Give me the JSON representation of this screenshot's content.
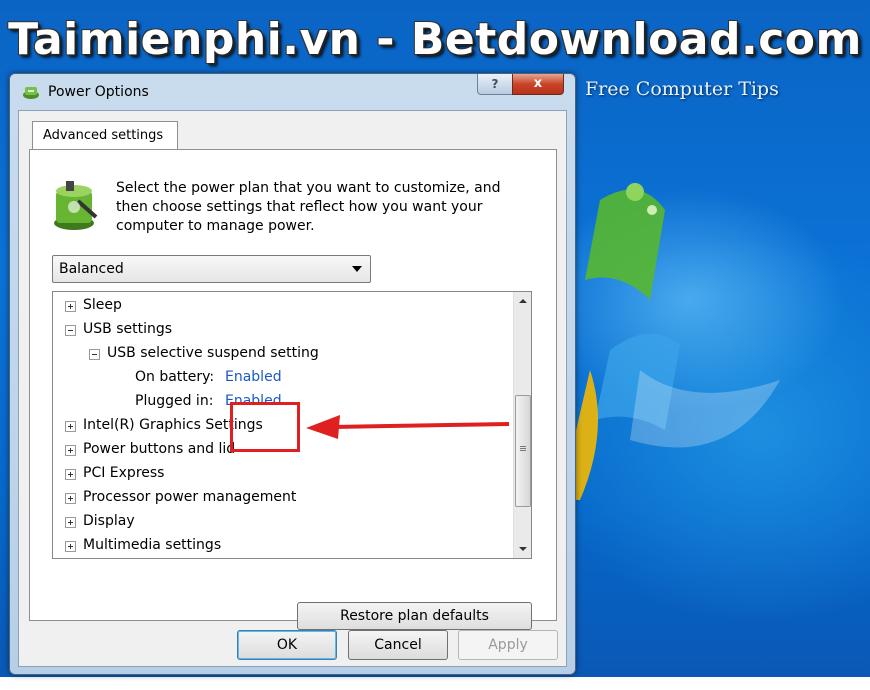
{
  "banner": {
    "title": "Taimienphi.vn - Betdownload.com",
    "tagline": "Free Computer Tips"
  },
  "window": {
    "title": "Power Options",
    "help_label": "?",
    "close_label": "x",
    "tab_label": "Advanced settings",
    "description": "Select the power plan that you want to customize, and then choose settings that reflect how you want your computer to manage power.",
    "plan_select": {
      "value": "Balanced"
    },
    "tree": [
      {
        "label": "Sleep",
        "expander": "plus",
        "indent": 0
      },
      {
        "label": "USB settings",
        "expander": "minus",
        "indent": 0
      },
      {
        "label": "USB selective suspend setting",
        "expander": "minus",
        "indent": 1
      },
      {
        "label": "On battery:",
        "value": "Enabled",
        "indent": 2
      },
      {
        "label": "Plugged in:",
        "value": "Enabled",
        "indent": 2
      },
      {
        "label": "Intel(R) Graphics Settings",
        "expander": "plus",
        "indent": 0
      },
      {
        "label": "Power buttons and lid",
        "expander": "plus",
        "indent": 0
      },
      {
        "label": "PCI Express",
        "expander": "plus",
        "indent": 0
      },
      {
        "label": "Processor power management",
        "expander": "plus",
        "indent": 0
      },
      {
        "label": "Display",
        "expander": "plus",
        "indent": 0
      },
      {
        "label": "Multimedia settings",
        "expander": "plus",
        "indent": 0
      }
    ],
    "restore_label": "Restore plan defaults",
    "ok_label": "OK",
    "cancel_label": "Cancel",
    "apply_label": "Apply"
  },
  "colors": {
    "desktop": "#0b72d6",
    "link": "#1a57c9",
    "highlight": "#e02020"
  }
}
